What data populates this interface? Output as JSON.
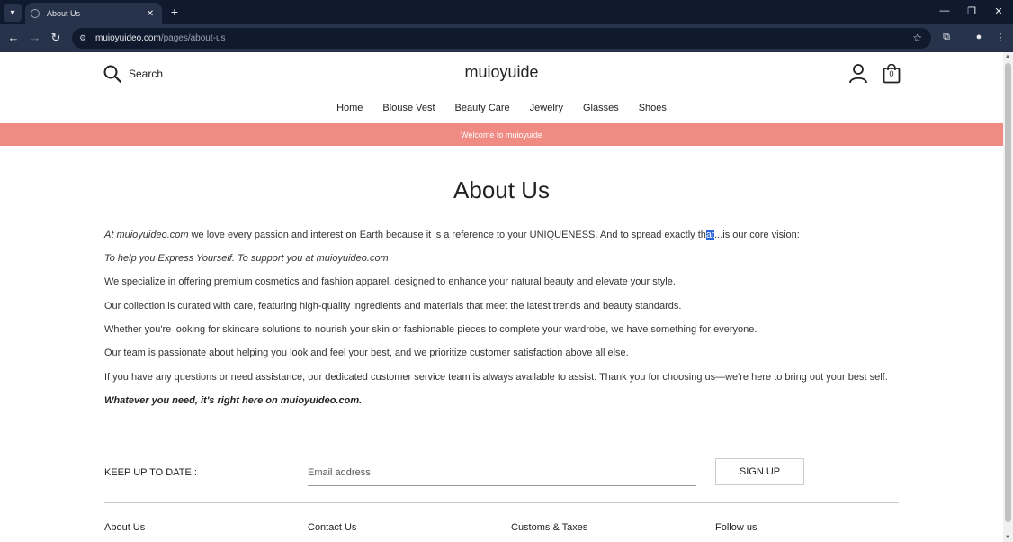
{
  "browser": {
    "tab_title": "About Us",
    "url_host": "muioyuideo.com",
    "url_path": "/pages/about-us"
  },
  "header": {
    "search_label": "Search",
    "logo": "muioyuide",
    "cart_count": "0"
  },
  "nav": {
    "items": [
      "Home",
      "Blouse Vest",
      "Beauty Care",
      "Jewelry",
      "Glasses",
      "Shoes"
    ]
  },
  "banner": {
    "text": "Welcome to muioyuide"
  },
  "page_title": "About Us",
  "content": {
    "p1_lead": "At muioyuideo.com",
    "p1_mid": " we love every passion and interest on Earth because it is a reference to your UNIQUENESS. And to spread exactly th",
    "p1_highlight": "at",
    "p1_tail": "...is our core vision:",
    "p2": "To help you Express Yourself. To support you at muioyuideo.com",
    "p3": "We specialize in offering premium cosmetics and fashion apparel, designed to enhance your natural beauty and elevate your style.",
    "p4": "Our collection is curated with care, featuring high-quality ingredients and materials that meet the latest trends and beauty standards.",
    "p5": "Whether you're looking for skincare solutions to nourish your skin or fashionable pieces to complete your wardrobe, we have something for everyone.",
    "p6": "Our team is passionate about helping you look and feel your best, and we prioritize customer satisfaction above all else.",
    "p7": "If you have any questions or need assistance, our dedicated customer service team is always available to assist. Thank you for choosing us—we're here to bring out your best self.",
    "p8": "Whatever you need, it's right here on muioyuideo.com."
  },
  "newsletter": {
    "label": "KEEP UP TO DATE :",
    "email_placeholder": "Email address",
    "button": "SIGN UP"
  },
  "footer": {
    "columns": [
      "About Us",
      "Contact Us",
      "Customs & Taxes",
      "Follow us"
    ]
  }
}
